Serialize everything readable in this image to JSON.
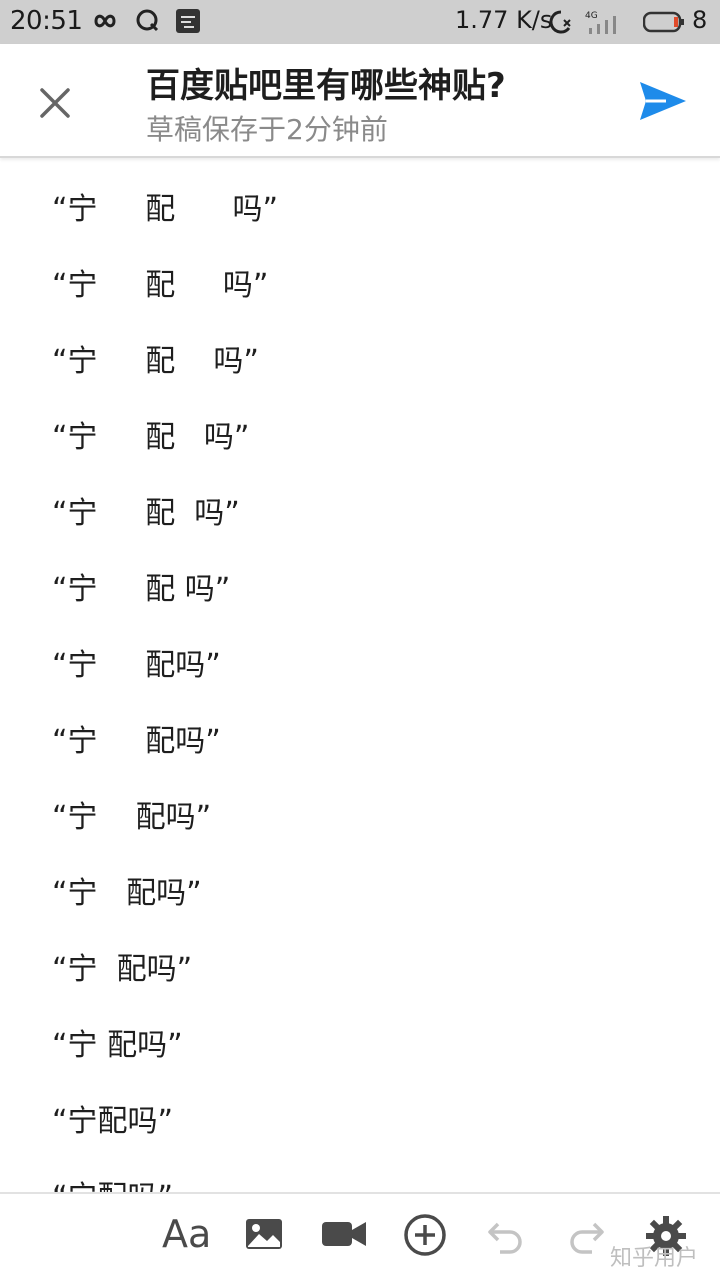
{
  "status_bar": {
    "time": "20:51",
    "net_speed": "1.77 K/s",
    "network": "4G",
    "battery": "8",
    "icons": [
      "infinity-icon",
      "q-icon",
      "app-notification-icon",
      "alarm-icon",
      "signal-icon",
      "battery-icon"
    ]
  },
  "header": {
    "title": "百度贴吧里有哪些神贴?",
    "subtitle": "草稿保存于2分钟前",
    "close_icon": "close-icon",
    "send_icon": "send-icon",
    "accent_color": "#1e8bea"
  },
  "content": {
    "lines": [
      "“宁     配      吗”",
      "“宁     配     吗”",
      "“宁     配    吗”",
      "“宁     配   吗”",
      "“宁     配  吗”",
      "“宁     配 吗”",
      "“宁     配吗”",
      "“宁     配吗”",
      "“宁    配吗”",
      "“宁   配吗”",
      "“宁  配吗”",
      "“宁 配吗”",
      "“宁配吗”",
      "“宁配吗”"
    ]
  },
  "toolbar": {
    "text_format_label": "Aa",
    "icons": [
      "text-format-icon",
      "image-icon",
      "video-icon",
      "add-icon",
      "undo-icon",
      "redo-icon",
      "settings-icon"
    ]
  },
  "watermark": "知乎用户"
}
